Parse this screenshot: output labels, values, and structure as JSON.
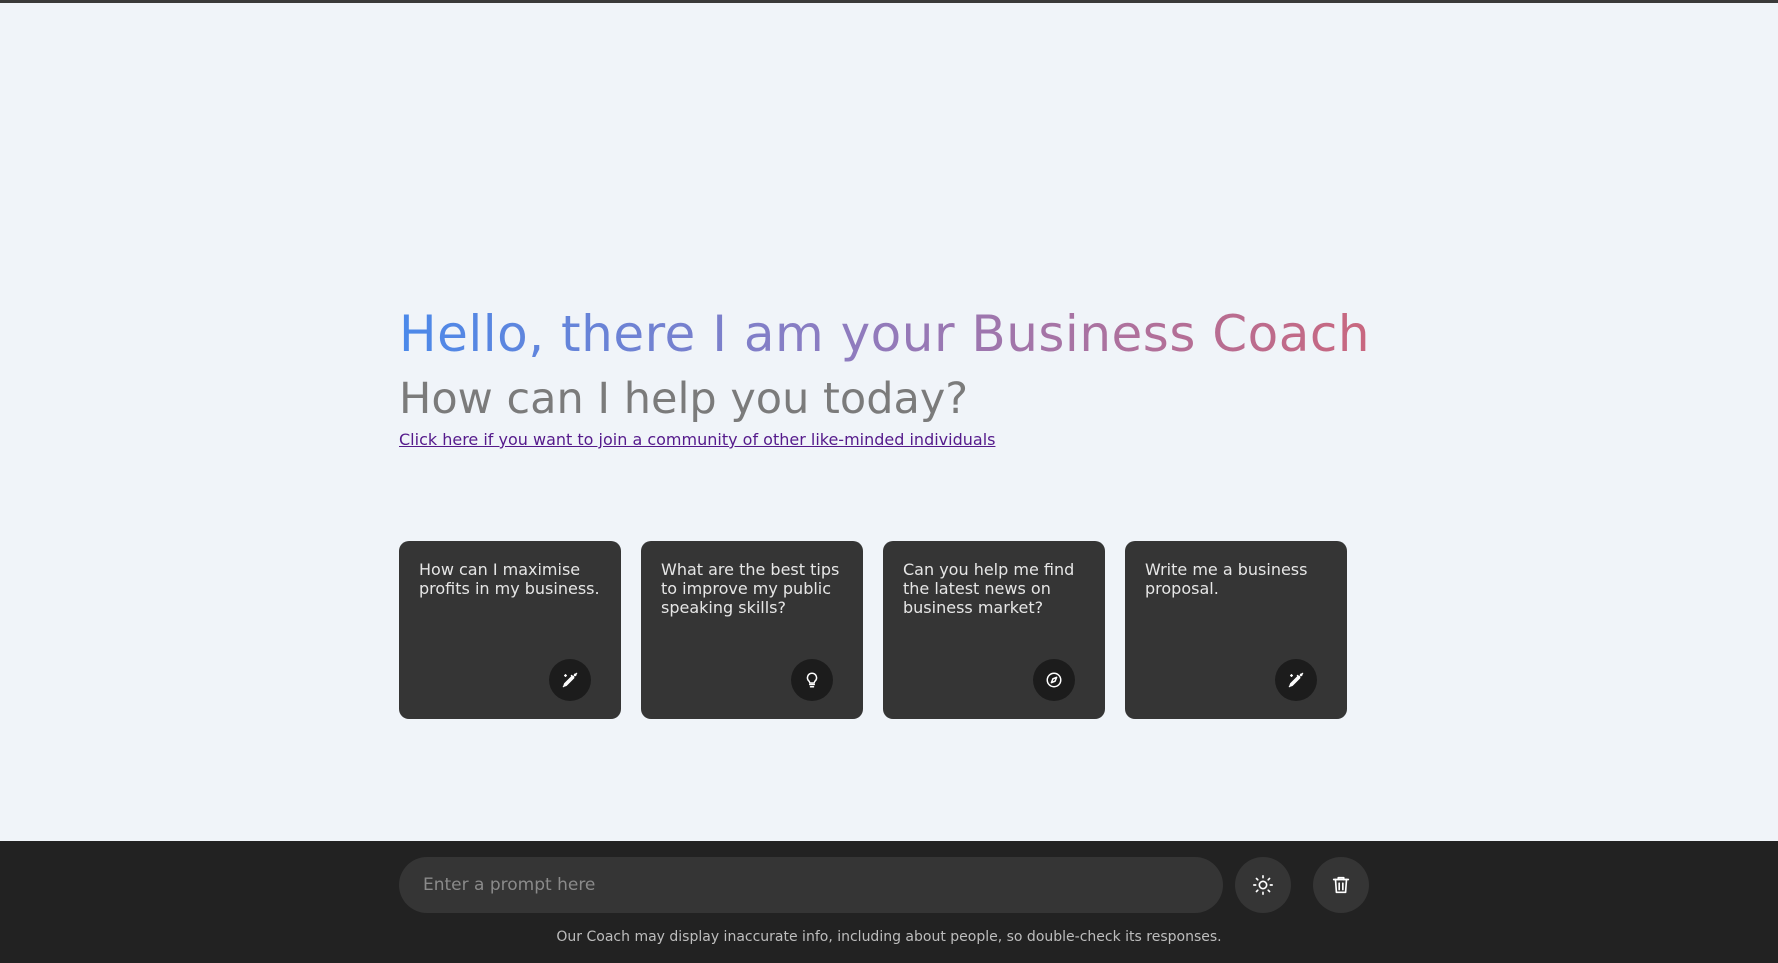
{
  "greeting": "Hello, there I am your Business Coach",
  "subtitle": "How can I help you today?",
  "community_link": "Click here if you want to join a community of other like-minded individuals",
  "cards": [
    {
      "text": "How can I maximise profits in my business.",
      "icon": "pen-sparkle-icon"
    },
    {
      "text": "What are the best tips to improve my public speaking skills?",
      "icon": "lightbulb-icon"
    },
    {
      "text": "Can you help me find the latest news on business market?",
      "icon": "compass-icon"
    },
    {
      "text": "Write me a business proposal.",
      "icon": "pen-sparkle-icon"
    }
  ],
  "prompt": {
    "placeholder": "Enter a prompt here",
    "value": ""
  },
  "footer": {
    "theme_icon": "sun-icon",
    "clear_icon": "trash-icon",
    "disclaimer": "Our Coach may display inaccurate info, including about people, so double-check its responses."
  },
  "colors": {
    "background": "#f0f4f9",
    "card_bg": "#353535",
    "footer_bg": "#222222",
    "gradient_start": "#4b89ea",
    "gradient_mid": "#8d7cc0",
    "gradient_end": "#c9677f",
    "link": "#551a8b"
  }
}
